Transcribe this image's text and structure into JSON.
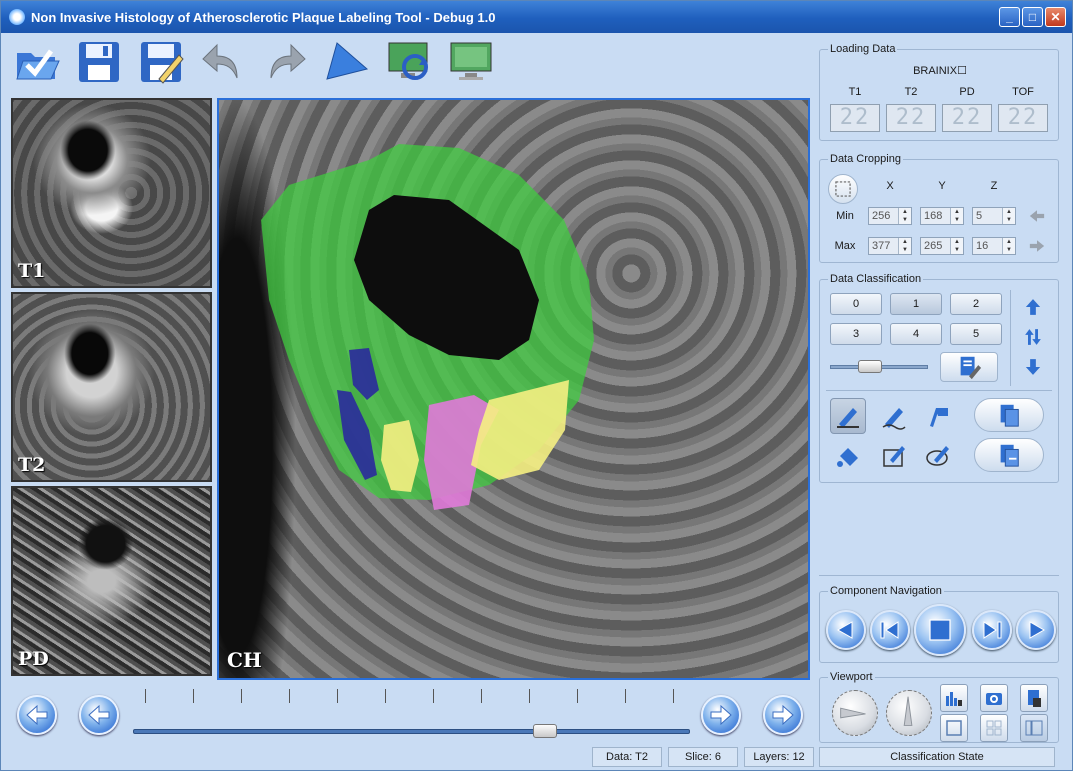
{
  "window": {
    "title": "Non Invasive Histology of Atherosclerotic Plaque Labeling Tool - Debug 1.0"
  },
  "toolbar": {
    "items": [
      {
        "name": "open-icon"
      },
      {
        "name": "save-icon"
      },
      {
        "name": "save-as-icon"
      },
      {
        "name": "undo-icon"
      },
      {
        "name": "redo-icon"
      },
      {
        "name": "play-icon"
      },
      {
        "name": "refresh-display-icon"
      },
      {
        "name": "monitor-icon"
      }
    ]
  },
  "thumbnails": [
    {
      "label": "T1"
    },
    {
      "label": "T2"
    },
    {
      "label": "PD"
    }
  ],
  "main_view": {
    "label": "CH"
  },
  "status": {
    "data": "Data: T2",
    "slice": "Slice: 6",
    "layers": "Layers: 12",
    "classification": "Classification State"
  },
  "slider": {
    "value_fraction": 0.74
  },
  "loading": {
    "title": "Loading Data",
    "dataset": "BRAINIX☐",
    "channels": [
      "T1",
      "T2",
      "PD",
      "TOF"
    ],
    "lcd_value": "22"
  },
  "cropping": {
    "title": "Data Cropping",
    "axes": [
      "X",
      "Y",
      "Z"
    ],
    "min_label": "Min",
    "max_label": "Max",
    "min": [
      "256",
      "168",
      "5"
    ],
    "max": [
      "377",
      "265",
      "16"
    ]
  },
  "classification": {
    "title": "Data Classification",
    "buttons": [
      "0",
      "1",
      "2",
      "3",
      "4",
      "5"
    ],
    "active": "1"
  },
  "component_nav": {
    "title": "Component Navigation"
  },
  "viewport": {
    "title": "Viewport"
  },
  "colors": {
    "accent": "#2a6fd8",
    "mask_green": "#3fcf3f",
    "mask_blue": "#2a2a9c",
    "mask_yellow": "#f5ef82",
    "mask_pink": "#e07ad8"
  }
}
